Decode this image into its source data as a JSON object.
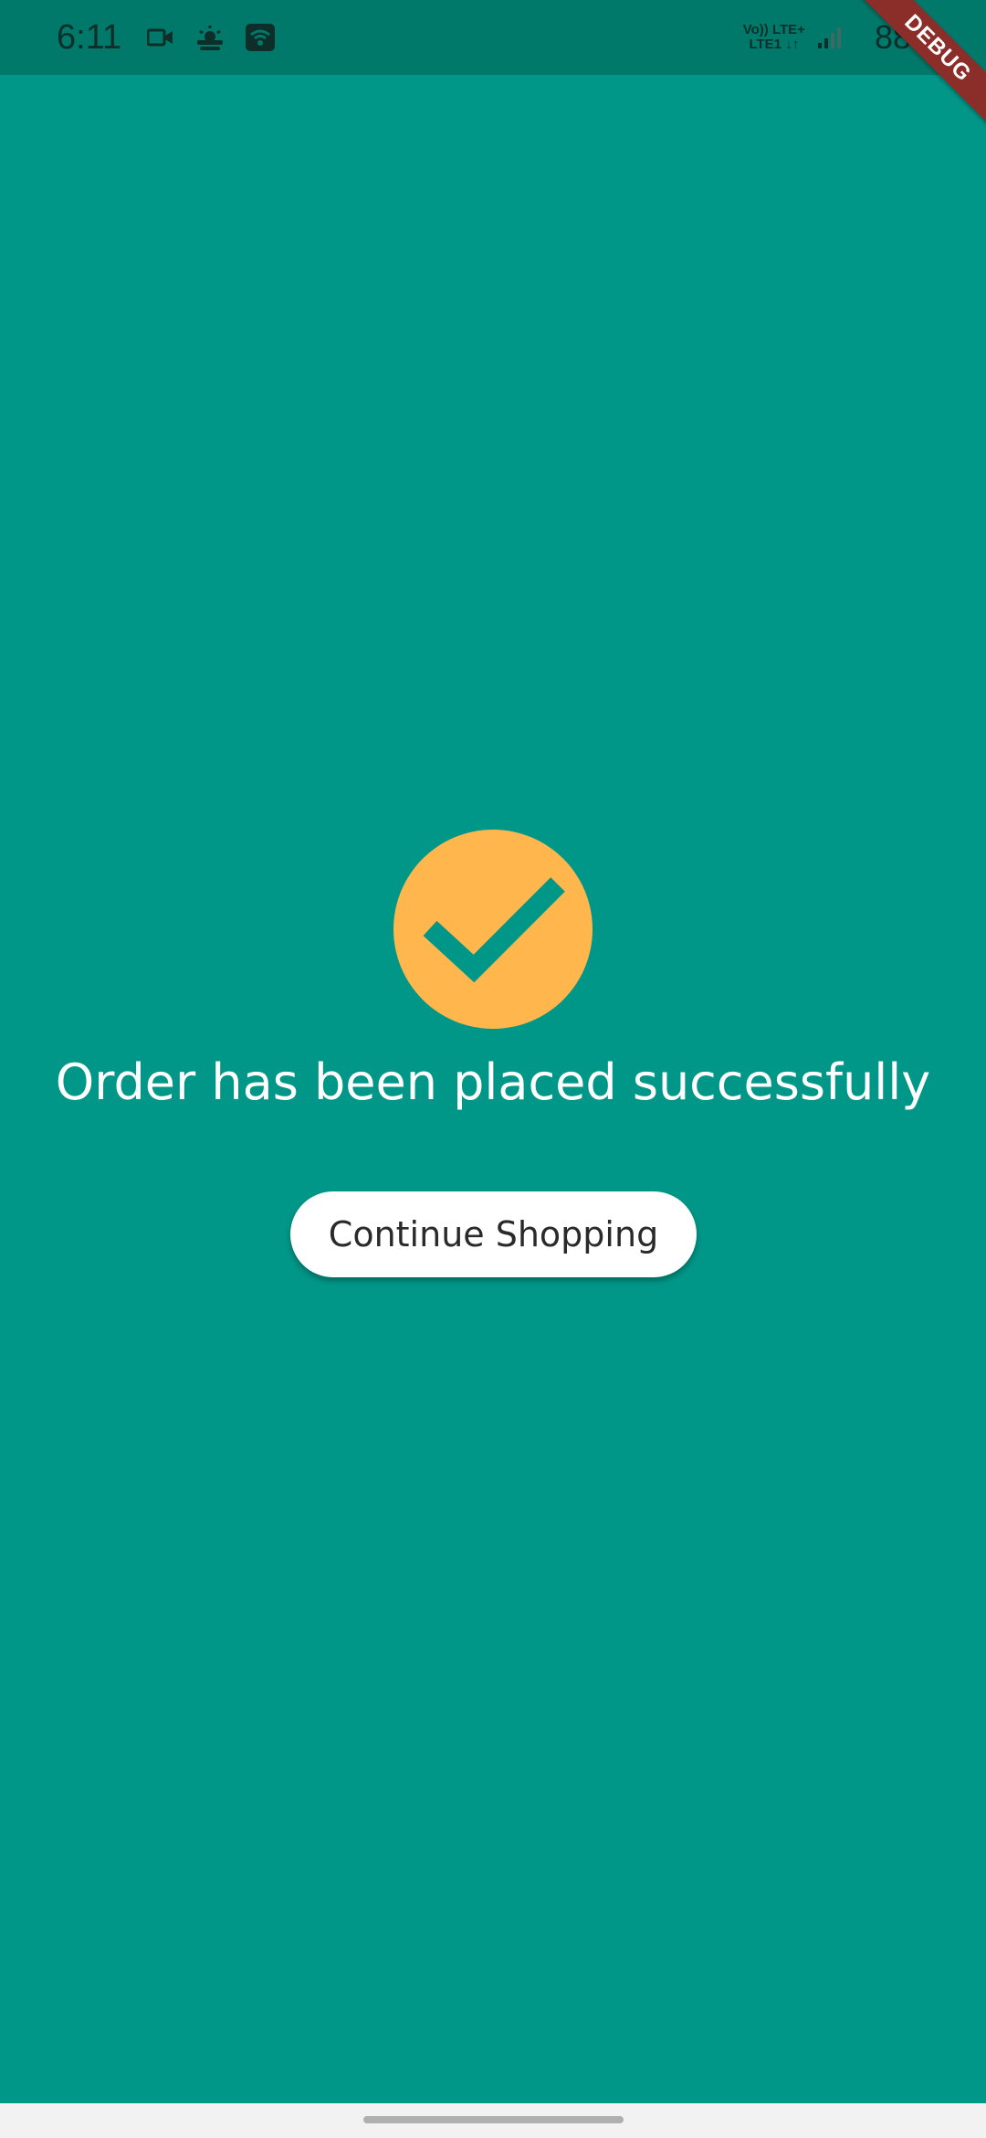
{
  "status_bar": {
    "time": "6:11",
    "network_top": "Vo)) LTE+",
    "network_bottom": "LTE1 ↓↑",
    "battery": "88%",
    "icons": [
      "video-icon",
      "weather-icon",
      "wifi-icon",
      "signal-icon"
    ]
  },
  "debug_banner": "DEBUG",
  "main": {
    "success_icon": "check-circle-icon",
    "message": "Order has been placed successfully",
    "button_label": "Continue Shopping"
  },
  "colors": {
    "background": "#009688",
    "status_bar": "#00796b",
    "check_circle": "#ffb74d",
    "button_bg": "#ffffff",
    "debug_ribbon": "#8b2e2a"
  }
}
